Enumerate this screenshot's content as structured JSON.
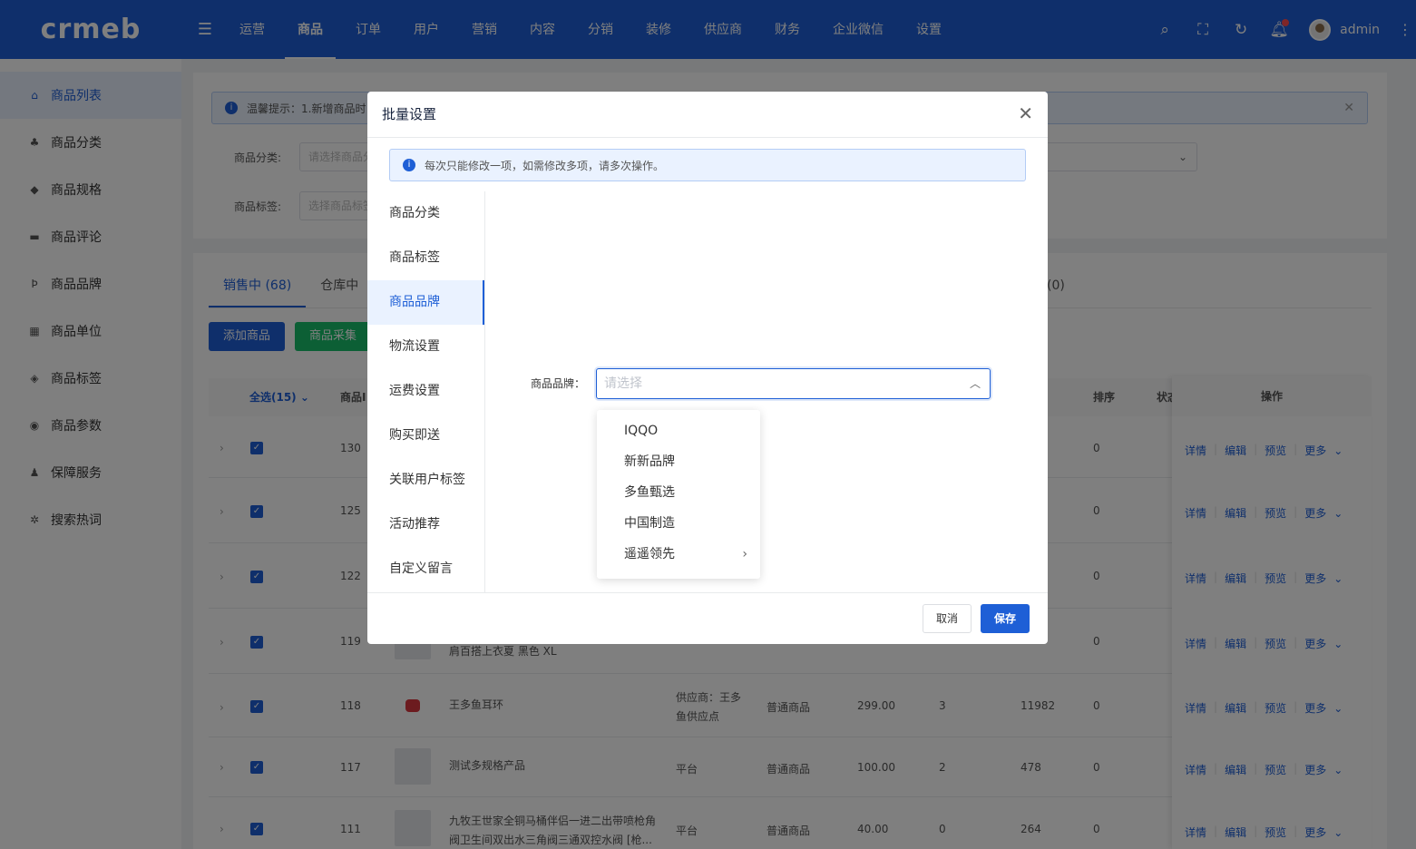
{
  "brand": {
    "logo": "crmeb",
    "accent": "#1e5fd6"
  },
  "header": {
    "nav": [
      "运营",
      "商品",
      "订单",
      "用户",
      "营销",
      "内容",
      "分销",
      "装修",
      "供应商",
      "财务",
      "企业微信",
      "设置"
    ],
    "active_nav": "商品",
    "username": "admin"
  },
  "sidebar": {
    "items": [
      {
        "label": "商品列表",
        "icon": "goods-icon"
      },
      {
        "label": "商品分类",
        "icon": "category-icon"
      },
      {
        "label": "商品规格",
        "icon": "cube-icon"
      },
      {
        "label": "商品评论",
        "icon": "comment-icon"
      },
      {
        "label": "商品品牌",
        "icon": "brand-icon"
      },
      {
        "label": "商品单位",
        "icon": "grid-icon"
      },
      {
        "label": "商品标签",
        "icon": "tag-icon"
      },
      {
        "label": "商品参数",
        "icon": "eye-icon"
      },
      {
        "label": "保障服务",
        "icon": "guarantee-icon"
      },
      {
        "label": "搜索热词",
        "icon": "hotword-icon"
      }
    ]
  },
  "page": {
    "tip": "温馨提示：1.新增商品时",
    "filters": {
      "category_label": "商品分类:",
      "category_placeholder": "请选择商品分",
      "tag_label": "商品标签:",
      "tag_placeholder": "选择商品标签"
    },
    "tabs": [
      "销售中 (68)",
      "仓库中",
      "(0)"
    ],
    "buttons": {
      "add": "添加商品",
      "collect": "商品采集"
    },
    "table": {
      "headers": {
        "select_all": "全选(15)",
        "id": "商品I",
        "sort": "排序",
        "status": "状态",
        "ops": "操作"
      },
      "rows": [
        {
          "id": "130",
          "name": "",
          "supplier": "",
          "type": "",
          "price": "",
          "sales": "",
          "stock": "",
          "sort": "0"
        },
        {
          "id": "125",
          "name": "",
          "supplier": "",
          "type": "",
          "price": "",
          "sales": "",
          "stock": "",
          "sort": "0"
        },
        {
          "id": "122",
          "name": "",
          "supplier": "",
          "type": "",
          "price": "",
          "sales": "",
          "stock": "",
          "sort": "0"
        },
        {
          "id": "119",
          "name": "肩百搭上衣夏 黑色 XL",
          "supplier": "",
          "type": "",
          "price": "",
          "sales": "",
          "stock": "",
          "sort": "0"
        },
        {
          "id": "118",
          "name": "王多鱼耳环",
          "supplier": "供应商：王多鱼供应点",
          "type": "普通商品",
          "price": "299.00",
          "sales": "3",
          "stock": "11982",
          "sort": "0"
        },
        {
          "id": "117",
          "name": "测试多规格产品",
          "supplier": "平台",
          "type": "普通商品",
          "price": "100.00",
          "sales": "2",
          "stock": "478",
          "sort": "0"
        },
        {
          "id": "111",
          "name": "九牧王世家全铜马桶伴侣一进二出带喷枪角阀卫生间双出水三角阀三通双控水阀 [枪...",
          "supplier": "平台",
          "type": "普通商品",
          "price": "40.00",
          "sales": "0",
          "stock": "264",
          "sort": "0"
        }
      ],
      "ops": {
        "detail": "详情",
        "edit": "编辑",
        "preview": "预览",
        "more": "更多"
      }
    }
  },
  "modal": {
    "title": "批量设置",
    "tip": "每次只能修改一项，如需修改多项，请多次操作。",
    "menu": [
      "商品分类",
      "商品标签",
      "商品品牌",
      "物流设置",
      "运费设置",
      "购买即送",
      "关联用户标签",
      "活动推荐",
      "自定义留言"
    ],
    "active_menu": "商品品牌",
    "field_label": "商品品牌：",
    "select_placeholder": "请选择",
    "options": [
      "IQQO",
      "新新品牌",
      "多鱼甄选",
      "中国制造",
      "遥遥领先"
    ],
    "cancel": "取消",
    "save": "保存"
  }
}
